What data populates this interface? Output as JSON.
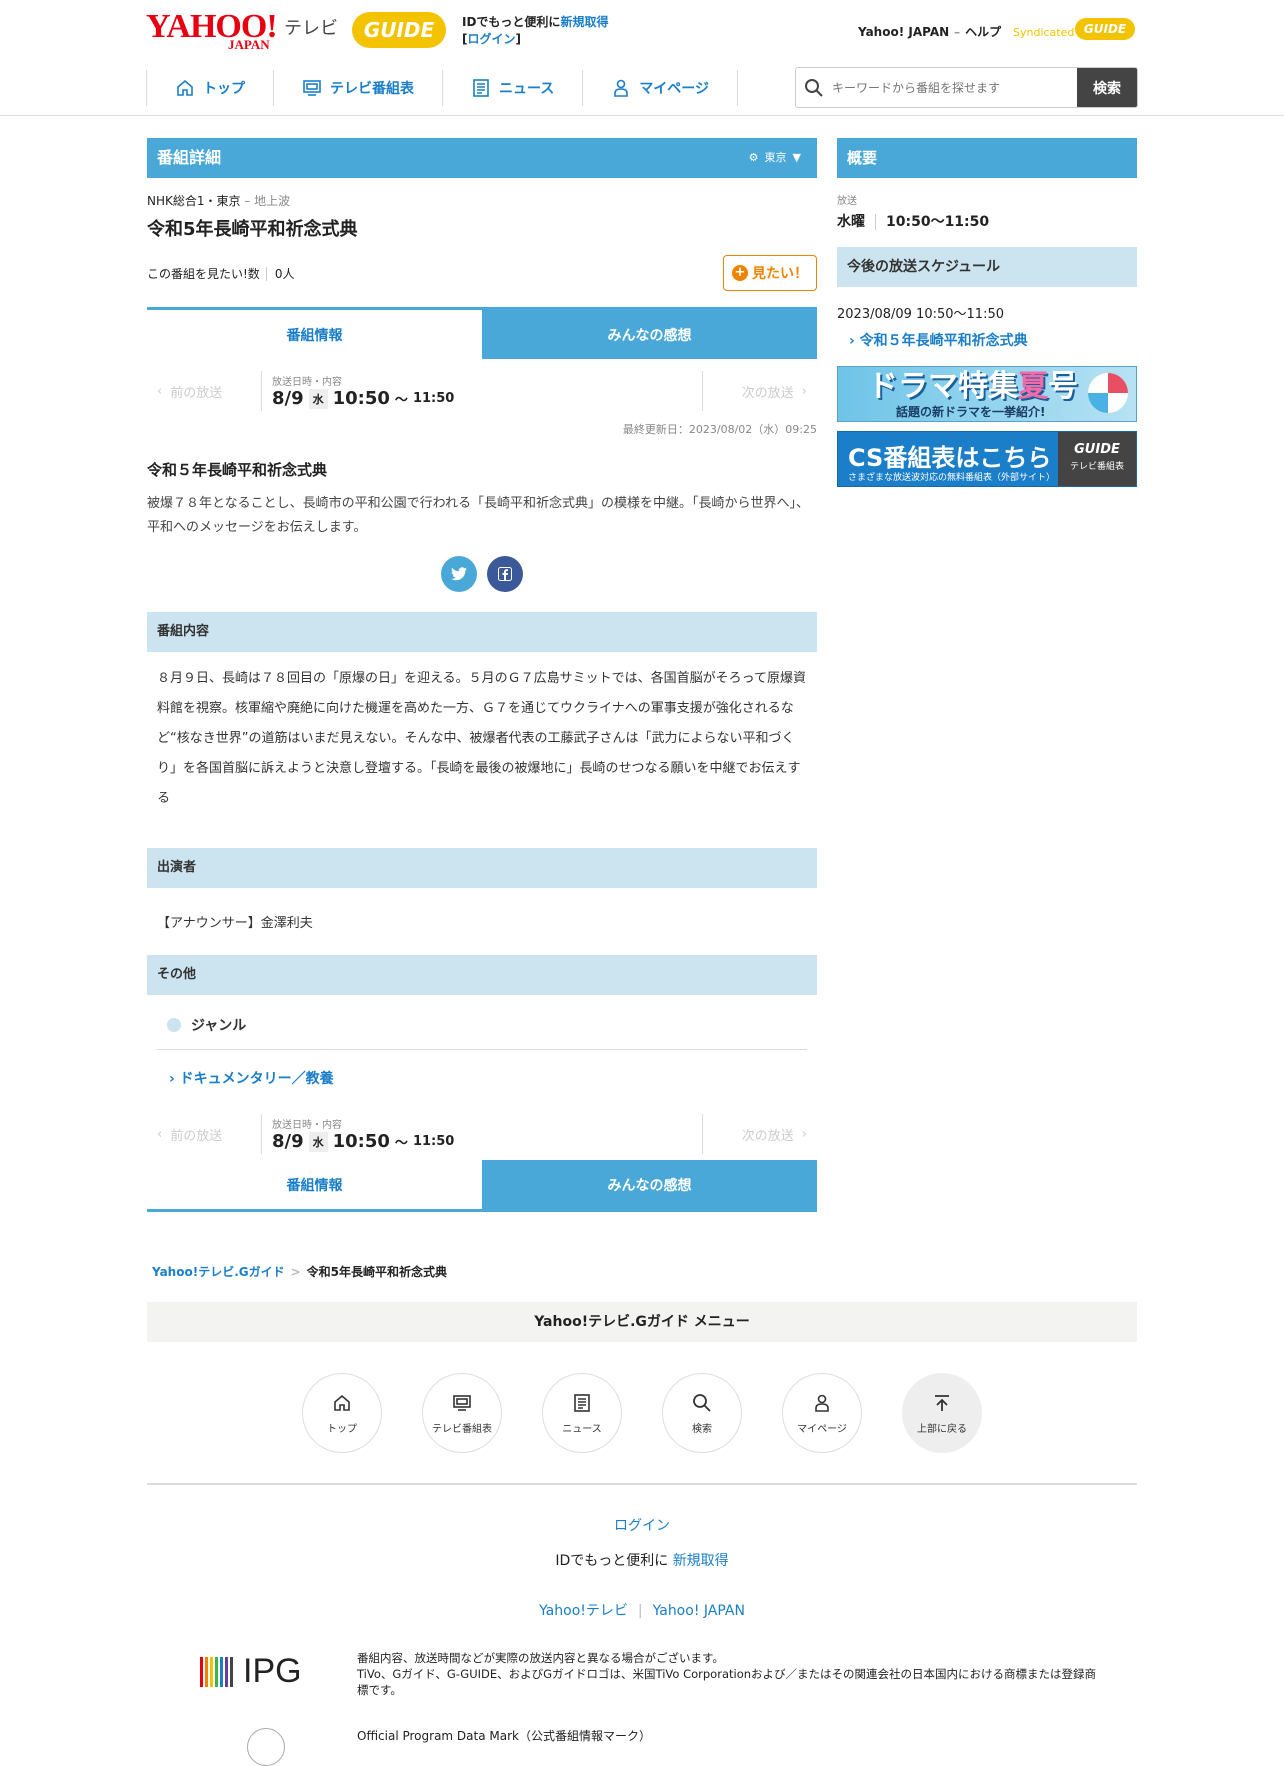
{
  "header": {
    "yahoo_logo": "YAHOO!",
    "yahoo_logo_sub": "JAPAN",
    "tv_label": "テレビ",
    "gguide_logo": "GUIDE",
    "id_text_1": "IDでもっと便利に",
    "id_signup": "新規取得",
    "id_login": "ログイン",
    "top_links": [
      "Yahoo! JAPAN",
      "ヘルプ"
    ],
    "syndicated_text": "Syndicated",
    "syndicated_logo": "GUIDE"
  },
  "nav": {
    "items": [
      {
        "label": "トップ",
        "icon": "home-icon"
      },
      {
        "label": "テレビ番組表",
        "icon": "tv-icon"
      },
      {
        "label": "ニュース",
        "icon": "news-icon"
      },
      {
        "label": "マイページ",
        "icon": "user-icon"
      }
    ]
  },
  "search": {
    "placeholder": "キーワードから番組を探せます",
    "button": "検索"
  },
  "main": {
    "section_title": "番組詳細",
    "region": "東京",
    "station": "NHK総合1・東京",
    "station_type": "地上波",
    "program_title": "令和5年長崎平和祈念式典",
    "want_label": "この番組を見たい!数",
    "want_count": "0人",
    "want_button": "見たい！",
    "tabs": [
      "番組情報",
      "みんなの感想"
    ],
    "airnav": {
      "prev": "前の放送",
      "next": "次の放送",
      "label": "放送日時・内容",
      "date": "8/9",
      "dow": "水",
      "start": "10:50",
      "tilde": "〜",
      "end": "11:50"
    },
    "updated": "最終更新日：2023/08/02（水）09:25",
    "desc_title": "令和５年長崎平和祈念式典",
    "desc_text": "被爆７８年となることし、長崎市の平和公園で行われる「長崎平和祈念式典」の模様を中継。「長崎から世界へ」、平和へのメッセージをお伝えします。",
    "content_head": "番組内容",
    "content_text": "８月９日、長崎は７８回目の「原爆の日」を迎える。５月のＧ７広島サミットでは、各国首脳がそろって原爆資料館を視察。核軍縮や廃絶に向けた機運を高めた一方、Ｇ７を通じてウクライナへの軍事支援が強化されるなど“核なき世界”の道筋はいまだ見えない。そんな中、被爆者代表の工藤武子さんは「武力によらない平和づくり」を各国首脳に訴えようと決意し登壇する。「長崎を最後の被爆地に」長崎のせつなる願いを中継でお伝えする",
    "cast_head": "出演者",
    "cast_text": "【アナウンサー】金澤利夫",
    "other_head": "その他",
    "genre_label": "ジャンル",
    "genre_link": "ドキュメンタリー／教養"
  },
  "side": {
    "section_title": "概要",
    "broadcast_label": "放送",
    "broadcast_dow": "水曜",
    "broadcast_time": "10:50〜11:50",
    "schedule_head": "今後の放送スケジュール",
    "schedule_date": "2023/08/09 10:50〜11:50",
    "schedule_link": "令和５年長崎平和祈念式典",
    "banner1_title_a": "ドラマ特集",
    "banner1_title_b": "夏",
    "banner1_title_c": "号",
    "banner1_sub": "話題の新ドラマを一挙紹介!",
    "banner2_title": "CS番組表はこちら",
    "banner2_sub": "さまざまな放送波対応の無料番組表（外部サイト）",
    "banner2_logo": "GUIDE",
    "banner2_logo_sub": "テレビ番組表"
  },
  "footer": {
    "breadcrumb": [
      "Yahoo!テレビ.Gガイド",
      "令和5年長崎平和祈念式典"
    ],
    "menu_head": "Yahoo!テレビ.Gガイド メニュー",
    "circles": [
      {
        "label": "トップ",
        "icon": "home-icon"
      },
      {
        "label": "テレビ番組表",
        "icon": "tv-icon"
      },
      {
        "label": "ニュース",
        "icon": "news-icon"
      },
      {
        "label": "検索",
        "icon": "search-icon"
      },
      {
        "label": "マイページ",
        "icon": "user-icon"
      },
      {
        "label": "上部に戻る",
        "icon": "arrow-up-icon"
      }
    ],
    "login": "ログイン",
    "id_text": "IDでもっと便利に",
    "id_signup": "新規取得",
    "links": [
      "Yahoo!テレビ",
      "Yahoo! JAPAN"
    ],
    "ipg": "IPG",
    "disclaimer_1": "番組内容、放送時間などが実際の放送内容と異なる場合がございます。",
    "disclaimer_2": "TiVo、Gガイド、G-GUIDE、およびGガイドロゴは、米国TiVo Corporationおよび／またはその関連会社の日本国内における商標または登録商標です。",
    "opdm": "Official Program Data Mark（公式番組情報マーク）"
  },
  "colors": {
    "accent": "#4aa8d8",
    "link": "#1a7ec8",
    "light_head": "#cce4ef",
    "want": "#f08300",
    "yahoo_red": "#e60012",
    "gguide_yellow": "#f3c300"
  }
}
